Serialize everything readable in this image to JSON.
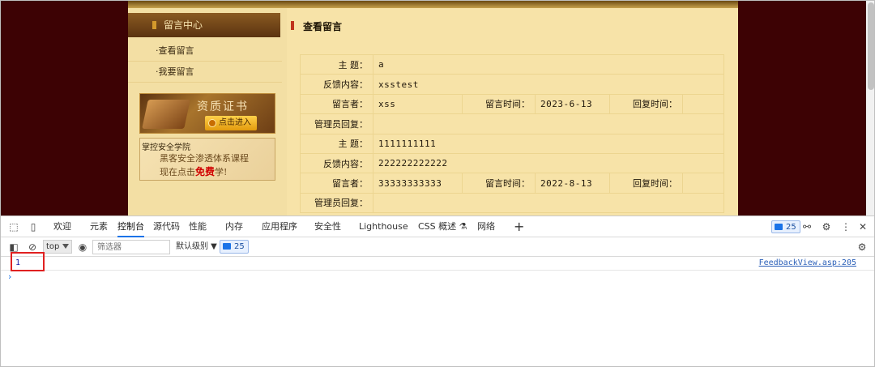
{
  "left_panel": {
    "header": "留言中心",
    "items": [
      "·查看留言",
      "·我要留言"
    ],
    "cert_title": "资质证书",
    "cert_button": "点击进入",
    "school_name": "掌控安全学院",
    "school_line1": "黑客安全渗透体系课程",
    "school_line2_pre": "现在点击",
    "school_line2_free": "免费",
    "school_line2_post": "学!"
  },
  "main": {
    "title": "查看留言",
    "labels": {
      "subject": "主  题：",
      "content": "反馈内容：",
      "author": "留言者：",
      "time": "留言时间：",
      "reply_time": "回复时间：",
      "admin_reply": "管理员回复："
    },
    "entries": [
      {
        "subject": "a",
        "content": "xsstest",
        "author": "xss",
        "time": "2023-6-13",
        "reply_time": "",
        "admin_reply": ""
      },
      {
        "subject": "1111111111",
        "content": "222222222222",
        "author": "33333333333",
        "time": "2022-8-13",
        "reply_time": "",
        "admin_reply": ""
      }
    ]
  },
  "devtools": {
    "tabs": [
      "欢迎",
      "元素",
      "控制台",
      "源代码",
      "性能",
      "内存",
      "应用程序",
      "安全性",
      "Lighthouse",
      "CSS 概述 ⚗",
      "网络"
    ],
    "active_tab": "控制台",
    "add_tab": "+",
    "issue_count": "25",
    "context": "top",
    "filter_placeholder": "筛选器",
    "level": "默认级别 ▼",
    "level_count": "25",
    "log_value": "1",
    "log_source": "FeedbackView.asp:205",
    "prompt": "›"
  },
  "colors": {
    "page_background": "#3d0204",
    "content_background": "#f7e3a8",
    "highlight": "#e02020",
    "accent": "#1a73e8"
  }
}
